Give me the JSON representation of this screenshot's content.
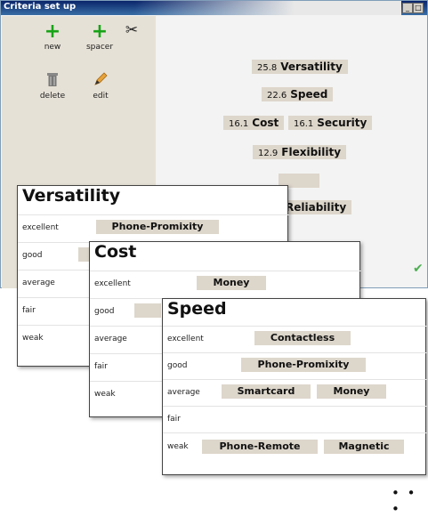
{
  "window": {
    "title": "Criteria set up"
  },
  "toolbar": {
    "new_label": "new",
    "spacer_label": "spacer",
    "delete_label": "delete",
    "edit_label": "edit"
  },
  "criteria": [
    {
      "name": "Versatility",
      "weight": "25.8"
    },
    {
      "name": "Speed",
      "weight": "22.6"
    },
    {
      "name": "Cost",
      "weight": "16.1"
    },
    {
      "name": "Security",
      "weight": "16.1"
    },
    {
      "name": "Flexibility",
      "weight": "12.9"
    },
    {
      "name": "",
      "weight": ""
    },
    {
      "name": "Reliability",
      "weight": ""
    }
  ],
  "panels": {
    "versatility": {
      "title": "Versatility",
      "rows": [
        {
          "label": "excellent",
          "items": [
            "Phone-Promixity"
          ]
        },
        {
          "label": "good",
          "items": []
        },
        {
          "label": "average",
          "items": []
        },
        {
          "label": "fair",
          "items": []
        },
        {
          "label": "weak",
          "items": []
        }
      ]
    },
    "cost": {
      "title": "Cost",
      "rows": [
        {
          "label": "excellent",
          "items": [
            "Money"
          ]
        },
        {
          "label": "good",
          "items": []
        },
        {
          "label": "average",
          "items": []
        },
        {
          "label": "fair",
          "items": []
        },
        {
          "label": "weak",
          "items": []
        }
      ]
    },
    "speed": {
      "title": "Speed",
      "rows": [
        {
          "label": "excellent",
          "items": [
            "Contactless"
          ]
        },
        {
          "label": "good",
          "items": [
            "Phone-Promixity"
          ]
        },
        {
          "label": "average",
          "items": [
            "Smartcard",
            "Money"
          ]
        },
        {
          "label": "fair",
          "items": []
        },
        {
          "label": "weak",
          "items": [
            "Phone-Remote",
            "Magnetic"
          ]
        }
      ]
    }
  },
  "more_indicator": "• • •",
  "colors": {
    "chip": "#ddd6cb",
    "title_bar": "#0a246a",
    "check": "#4caf50"
  }
}
